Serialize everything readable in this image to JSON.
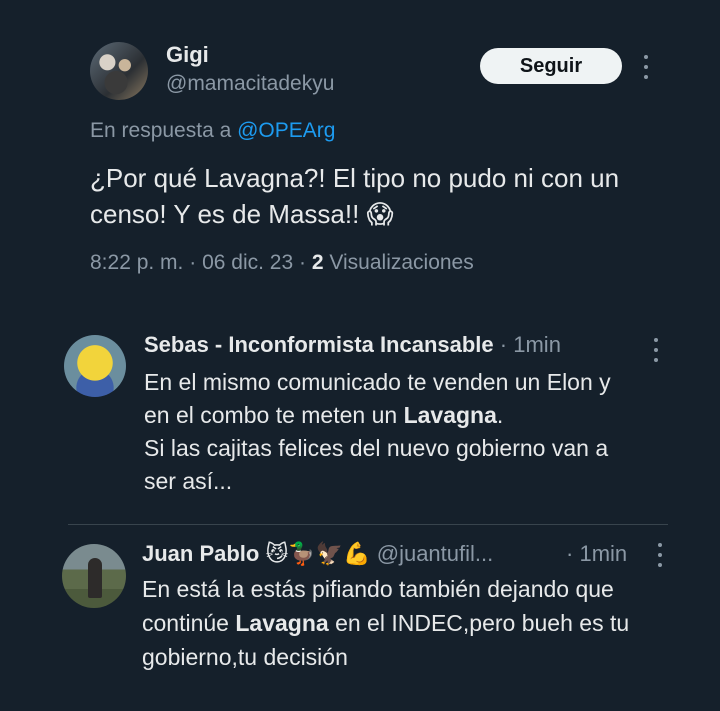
{
  "tweet": {
    "author_name": "Gigi",
    "author_handle": "@mamacitadekyu",
    "follow_label": "Seguir",
    "reply_prefix": "En respuesta a",
    "reply_to": "@OPEArg",
    "text_line1": "¿Por qué Lavagna?! El tipo no pudo ni con un",
    "text_line2": "censo! Y es de Massa!!",
    "emoji": "😱",
    "time": "8:22 p. m.",
    "sep1": "·",
    "date": "06 dic. 23",
    "sep2": "·",
    "views_count": "2",
    "views_label": "Visualizaciones"
  },
  "replies": [
    {
      "name": "Sebas - Inconformista Incansable",
      "sep": "·",
      "time": "1min",
      "line1": "En el mismo comunicado te venden un Elon y",
      "line2_pre": "en el combo te meten un ",
      "line2_bold": "Lavagna",
      "line2_post": ".",
      "line3": "Si las cajitas felices del nuevo gobierno van a",
      "line4": "ser así..."
    },
    {
      "name": "Juan Pablo",
      "emojis": "😼🦆🦅💪",
      "handle": "@juantufil...",
      "sep": "·",
      "time": "1min",
      "line1": "En está la estás pifiando también dejando que",
      "line2_pre": "continúe ",
      "line2_bold": "Lavagna",
      "line2_post": " en el INDEC,pero bueh es tu",
      "line3": "gobierno,tu decisión"
    }
  ]
}
